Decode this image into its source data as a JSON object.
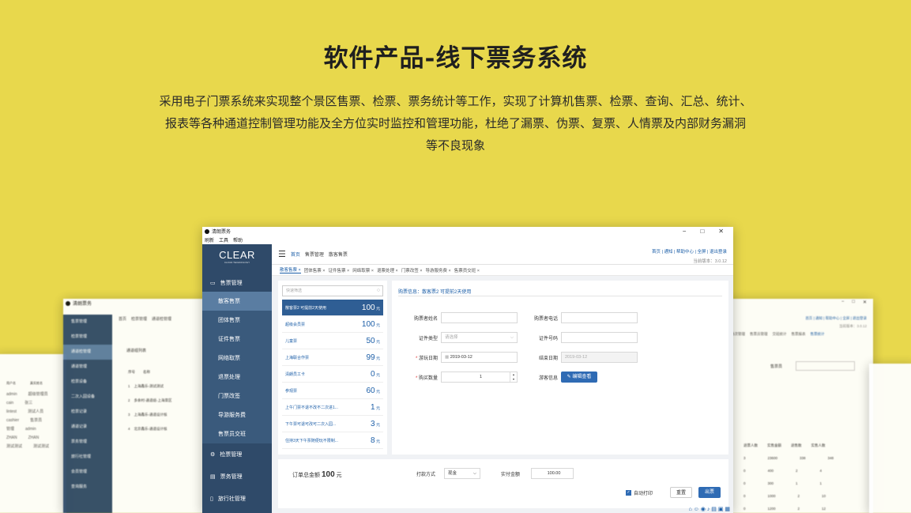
{
  "hero": {
    "title": "软件产品-线下票务系统",
    "desc_line1": "采用电子门票系统来实现整个景区售票、检票、票务统计等工作，实现了计算机售票、检票、查询、汇总、统计、",
    "desc_line2": "报表等各种通道控制管理功能及全方位实时监控和管理功能，杜绝了漏票、伪票、复票、人情票及内部财务漏洞",
    "desc_line3": "等不良现象"
  },
  "window": {
    "app_name": "清朗票务",
    "menu": [
      "刷新",
      "工具",
      "帮助"
    ],
    "controls": [
      "−",
      "□",
      "✕"
    ]
  },
  "sidebar": {
    "brand": "CLEAR",
    "brand_sub": "CLOUD TECHNOLOGY",
    "sections": [
      {
        "label": "售票管理",
        "items": [
          "散客售票",
          "团体售票",
          "证件售票",
          "网络取票",
          "退票处理",
          "门票改签",
          "导游服务费",
          "售票员交班"
        ]
      },
      {
        "label": "检票管理"
      },
      {
        "label": "票务管理"
      },
      {
        "label": "旅行社管理"
      }
    ]
  },
  "topnav": {
    "breadcrumb": [
      "首页",
      "售票管理",
      "散客售票"
    ],
    "right_links": "首页 | 通知 | 帮助中心 | 全屏 | 退出登录",
    "version": "当前版本：3.0.12"
  },
  "tabs": [
    "散客售票 ×",
    "团体售票 ×",
    "证件售票 ×",
    "网络取票 ×",
    "退票处理 ×",
    "门票改签 ×",
    "导游服务费 ×",
    "售票员交班 ×"
  ],
  "tickets": {
    "search_placeholder": "快速筛选",
    "items": [
      {
        "name": "散客票2 可提前2天使用",
        "price": "100",
        "unit": "元"
      },
      {
        "name": "超级会员票",
        "price": "100",
        "unit": "元"
      },
      {
        "name": "儿童票",
        "price": "50",
        "unit": "元"
      },
      {
        "name": "上海联合作票",
        "price": "99",
        "unit": "元"
      },
      {
        "name": "清朗员工卡",
        "price": "0",
        "unit": "元"
      },
      {
        "name": "参观票",
        "price": "60",
        "unit": "元"
      },
      {
        "name": "上午门票不退不改不二次进1...",
        "price": "1",
        "unit": "元"
      },
      {
        "name": "下午票可退可改可二次入园...",
        "price": "3",
        "unit": "元"
      },
      {
        "name": "住持3天下午票随便玩不限制...",
        "price": "8",
        "unit": "元"
      }
    ]
  },
  "form": {
    "title": "购票信息：散客票2 可提前2天使用",
    "buyer_name_label": "购票者姓名",
    "buyer_phone_label": "购票者电话",
    "id_type_label": "证件类型",
    "id_type_placeholder": "请选择",
    "id_no_label": "证件号码",
    "visit_date_label": "游玩日期",
    "visit_date": "2019-03-12",
    "end_date_label": "结束日期",
    "end_date": "2019-03-12",
    "qty_label": "购买数量",
    "qty": "1",
    "visitor_label": "游客信息",
    "edit_btn": "编辑查看"
  },
  "footer": {
    "total_label": "订单总金额",
    "total": "100",
    "total_unit": "元",
    "pay_label": "打款方式",
    "pay_value": "现金",
    "paid_label": "实付金额",
    "paid_value": "100.00",
    "auto_print": "自动打印",
    "reset_btn": "重置",
    "submit_btn": "出票"
  },
  "bg_left": {
    "menu": [
      "首页",
      "检票管理",
      "通道检管理"
    ],
    "side": [
      "售票管理",
      "检票管理",
      "通道检管理",
      "通道管理",
      "检票设备",
      "二次入园设备",
      "检票记录",
      "通道记录",
      "票务管理",
      "旅行社管理",
      "会员管理",
      "查询服务"
    ],
    "list_title": "通道组列表",
    "col1": "序号",
    "col2": "名称",
    "rows": [
      "上海鑫乐-测试测试",
      "多余村-通道组-上海景区",
      "上海鑫乐-通道设计核",
      "北京鑫乐-通道设计核"
    ]
  },
  "bg_right": {
    "links": "首页 | 通知 | 帮助中心 | 全屏 | 退出登录",
    "version": "当前版本：3.0.12",
    "tabs": [
      "场次管理",
      "售票员管理",
      "交班统计",
      "售票报表",
      "售票统计"
    ],
    "cols": [
      "退票人数",
      "实售金额",
      "退售数",
      "实售人数"
    ],
    "rows": [
      [
        "3",
        "23600",
        "338",
        "348"
      ],
      [
        "0",
        "400",
        "2",
        "4"
      ],
      [
        "0",
        "300",
        "1",
        "1"
      ],
      [
        "0",
        "1000",
        "2",
        "10"
      ],
      [
        "0",
        "1200",
        "2",
        "12"
      ]
    ],
    "seller_label": "售票员"
  },
  "bg_far_left": {
    "cols": [
      "用户名",
      "真实姓名"
    ],
    "rows": [
      [
        "admin",
        "超级管理员"
      ],
      [
        "cain",
        "张三"
      ],
      [
        "lintest",
        "测试人员"
      ],
      [
        "cashier",
        "售票员"
      ],
      [
        "管理",
        "admin"
      ],
      [
        "ZHAN",
        "ZHAN"
      ],
      [
        "测试测试",
        "测试测试"
      ]
    ]
  }
}
